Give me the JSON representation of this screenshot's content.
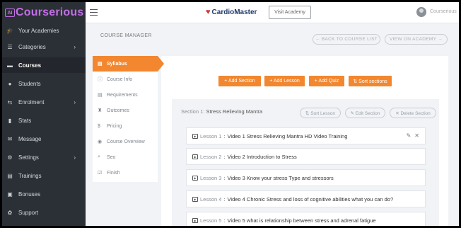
{
  "app": {
    "logo_badge": "AI",
    "logo_text": "Courserious"
  },
  "sidebar": {
    "items": [
      {
        "label": "Your Academies",
        "icon": "graduation-cap-icon",
        "glyph": "🎓",
        "chevron": ""
      },
      {
        "label": "Categories",
        "icon": "list-icon",
        "glyph": "☰",
        "chevron": "›"
      },
      {
        "label": "Courses",
        "icon": "book-icon",
        "glyph": "▬",
        "chevron": ""
      },
      {
        "label": "Students",
        "icon": "user-icon",
        "glyph": "●",
        "chevron": ""
      },
      {
        "label": "Enrolment",
        "icon": "enrol-icon",
        "glyph": "⇆",
        "chevron": "›"
      },
      {
        "label": "Stats",
        "icon": "chart-icon",
        "glyph": "▮",
        "chevron": ""
      },
      {
        "label": "Message",
        "icon": "chat-icon",
        "glyph": "✉",
        "chevron": ""
      },
      {
        "label": "Settings",
        "icon": "gear-icon",
        "glyph": "⚙",
        "chevron": "›"
      },
      {
        "label": "Trainings",
        "icon": "training-icon",
        "glyph": "▤",
        "chevron": ""
      },
      {
        "label": "Bonuses",
        "icon": "bonus-icon",
        "glyph": "▣",
        "chevron": ""
      },
      {
        "label": "Support",
        "icon": "support-icon",
        "glyph": "✿",
        "chevron": ""
      }
    ],
    "active": "Courses"
  },
  "topbar": {
    "brand": "CardioMaster",
    "visit_label": "Visit Academy",
    "user_name": "Courserious"
  },
  "page": {
    "title": "COURSE MANAGER",
    "back_label": "← BACK TO COURSE LIST",
    "view_label": "VIEW ON ACADEMY →"
  },
  "tabs": [
    {
      "label": "Syllabus",
      "icon": "list-icon",
      "glyph": "▤"
    },
    {
      "label": "Course Info",
      "icon": "info-icon",
      "glyph": "ⓘ"
    },
    {
      "label": "Requirements",
      "icon": "clipboard-icon",
      "glyph": "▤"
    },
    {
      "label": "Outcomes",
      "icon": "outcome-icon",
      "glyph": "♜"
    },
    {
      "label": "Pricing",
      "icon": "dollar-icon",
      "glyph": "$"
    },
    {
      "label": "Course Overview",
      "icon": "overview-icon",
      "glyph": "◉"
    },
    {
      "label": "Seo",
      "icon": "search-icon",
      "glyph": "⌕"
    },
    {
      "label": "Finish",
      "icon": "check-icon",
      "glyph": "☑"
    }
  ],
  "actions": {
    "add_section": "+ Add Section",
    "add_lesson": "+ Add Lesson",
    "add_quiz": "+ Add Quiz",
    "sort_sections": "⇅ Sort sections"
  },
  "section": {
    "prefix": "Section 1:",
    "name": "Stress Relieving Mantra",
    "sort_lesson": "⇅ Sort Lesson",
    "edit_section": "✎ Edit Section",
    "delete_section": "✕ Delete Section",
    "lessons": [
      {
        "num": "Lesson 1",
        "title": "Video 1 Stress Relieving Mantra HD Video Training"
      },
      {
        "num": "Lesson 2",
        "title": "Video 2 Introduction to Stress"
      },
      {
        "num": "Lesson 3",
        "title": "Video 3 Know your stress Type and stressors"
      },
      {
        "num": "Lesson 4",
        "title": "Video 4 Chronic Stress and loss of cognitive abilities what you can do?"
      },
      {
        "num": "Lesson 5",
        "title": "Video 5 what is relationship between stress and adrenal fatigue"
      }
    ]
  }
}
